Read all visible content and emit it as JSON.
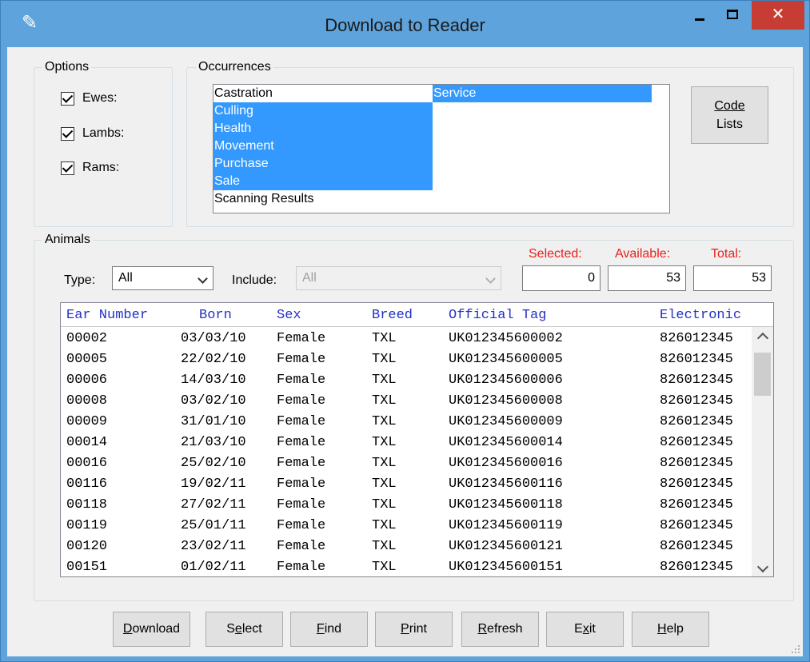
{
  "window": {
    "title": "Download to Reader",
    "minimize_label": "",
    "maximize_label": "",
    "close_label": "✕"
  },
  "options": {
    "label": "Options",
    "checkboxes": [
      {
        "label": "Ewes:",
        "checked": true
      },
      {
        "label": "Lambs:",
        "checked": true
      },
      {
        "label": "Rams:",
        "checked": true
      }
    ]
  },
  "occurrences": {
    "label": "Occurrences",
    "items": [
      {
        "label": "Castration",
        "selected": false
      },
      {
        "label": "Culling",
        "selected": true
      },
      {
        "label": "Health",
        "selected": true
      },
      {
        "label": "Movement",
        "selected": true
      },
      {
        "label": "Purchase",
        "selected": true
      },
      {
        "label": "Sale",
        "selected": true
      },
      {
        "label": "Scanning Results",
        "selected": false
      },
      {
        "label": "Service",
        "selected": true
      }
    ],
    "code_lists_line1": "Code",
    "code_lists_line2": "Lists"
  },
  "animals": {
    "label": "Animals",
    "type_label": "Type:",
    "type_value": "All",
    "include_label": "Include:",
    "include_value": "All",
    "selected_label": "Selected:",
    "available_label": "Available:",
    "total_label": "Total:",
    "selected_value": "0",
    "available_value": "53",
    "total_value": "53",
    "columns": [
      "Ear Number",
      "Born",
      "Sex",
      "Breed",
      "Official Tag",
      "Electronic"
    ],
    "rows": [
      [
        "00002",
        "03/03/10",
        "Female",
        "TXL",
        "UK012345600002",
        "826012345"
      ],
      [
        "00005",
        "22/02/10",
        "Female",
        "TXL",
        "UK012345600005",
        "826012345"
      ],
      [
        "00006",
        "14/03/10",
        "Female",
        "TXL",
        "UK012345600006",
        "826012345"
      ],
      [
        "00008",
        "03/02/10",
        "Female",
        "TXL",
        "UK012345600008",
        "826012345"
      ],
      [
        "00009",
        "31/01/10",
        "Female",
        "TXL",
        "UK012345600009",
        "826012345"
      ],
      [
        "00014",
        "21/03/10",
        "Female",
        "TXL",
        "UK012345600014",
        "826012345"
      ],
      [
        "00016",
        "25/02/10",
        "Female",
        "TXL",
        "UK012345600016",
        "826012345"
      ],
      [
        "00116",
        "19/02/11",
        "Female",
        "TXL",
        "UK012345600116",
        "826012345"
      ],
      [
        "00118",
        "27/02/11",
        "Female",
        "TXL",
        "UK012345600118",
        "826012345"
      ],
      [
        "00119",
        "25/01/11",
        "Female",
        "TXL",
        "UK012345600119",
        "826012345"
      ],
      [
        "00120",
        "23/02/11",
        "Female",
        "TXL",
        "UK012345600121",
        "826012345"
      ],
      [
        "00151",
        "01/02/11",
        "Female",
        "TXL",
        "UK012345600151",
        "826012345"
      ]
    ]
  },
  "buttons": {
    "download": {
      "pre": "",
      "key": "D",
      "post": "ownload"
    },
    "select": {
      "pre": "S",
      "key": "e",
      "post": "lect"
    },
    "find": {
      "pre": "",
      "key": "F",
      "post": "ind"
    },
    "print": {
      "pre": "",
      "key": "P",
      "post": "rint"
    },
    "refresh": {
      "pre": "",
      "key": "R",
      "post": "efresh"
    },
    "exit": {
      "pre": "E",
      "key": "x",
      "post": "it"
    },
    "help": {
      "pre": "",
      "key": "H",
      "post": "elp"
    }
  },
  "colors": {
    "titlebar": "#5ea3dc",
    "selection": "#3399ff",
    "header_text": "#2330c4",
    "count_label": "#e8201c",
    "close_button": "#c73d34"
  }
}
